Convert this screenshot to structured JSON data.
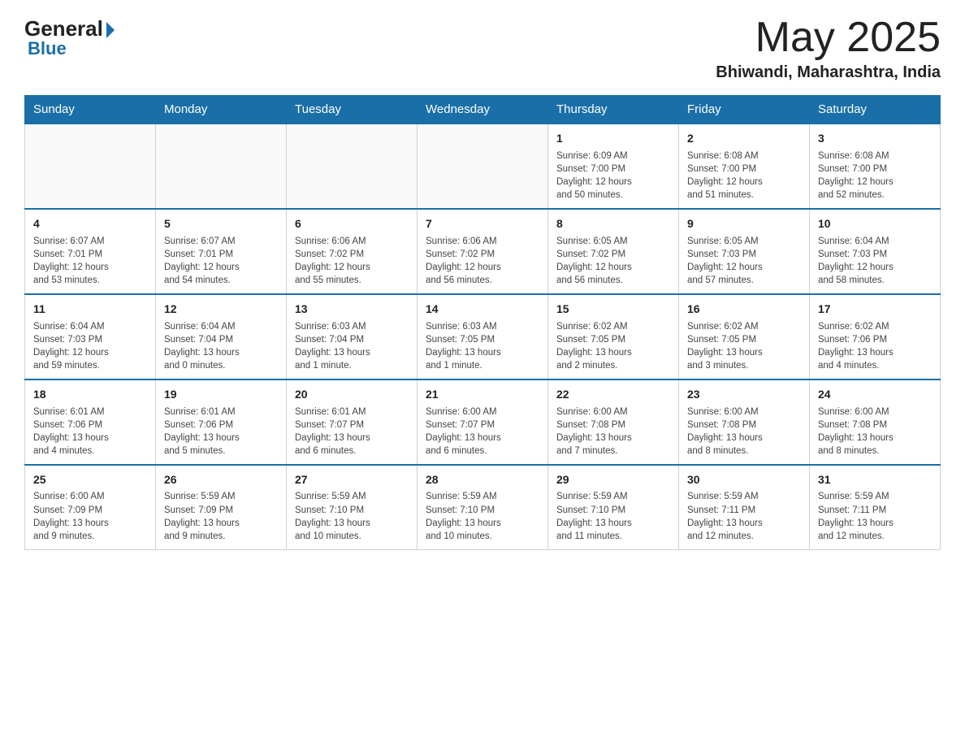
{
  "header": {
    "logo_general": "General",
    "logo_blue": "Blue",
    "month_title": "May 2025",
    "location": "Bhiwandi, Maharashtra, India"
  },
  "days_of_week": [
    "Sunday",
    "Monday",
    "Tuesday",
    "Wednesday",
    "Thursday",
    "Friday",
    "Saturday"
  ],
  "weeks": [
    [
      {
        "day": "",
        "info": ""
      },
      {
        "day": "",
        "info": ""
      },
      {
        "day": "",
        "info": ""
      },
      {
        "day": "",
        "info": ""
      },
      {
        "day": "1",
        "info": "Sunrise: 6:09 AM\nSunset: 7:00 PM\nDaylight: 12 hours\nand 50 minutes."
      },
      {
        "day": "2",
        "info": "Sunrise: 6:08 AM\nSunset: 7:00 PM\nDaylight: 12 hours\nand 51 minutes."
      },
      {
        "day": "3",
        "info": "Sunrise: 6:08 AM\nSunset: 7:00 PM\nDaylight: 12 hours\nand 52 minutes."
      }
    ],
    [
      {
        "day": "4",
        "info": "Sunrise: 6:07 AM\nSunset: 7:01 PM\nDaylight: 12 hours\nand 53 minutes."
      },
      {
        "day": "5",
        "info": "Sunrise: 6:07 AM\nSunset: 7:01 PM\nDaylight: 12 hours\nand 54 minutes."
      },
      {
        "day": "6",
        "info": "Sunrise: 6:06 AM\nSunset: 7:02 PM\nDaylight: 12 hours\nand 55 minutes."
      },
      {
        "day": "7",
        "info": "Sunrise: 6:06 AM\nSunset: 7:02 PM\nDaylight: 12 hours\nand 56 minutes."
      },
      {
        "day": "8",
        "info": "Sunrise: 6:05 AM\nSunset: 7:02 PM\nDaylight: 12 hours\nand 56 minutes."
      },
      {
        "day": "9",
        "info": "Sunrise: 6:05 AM\nSunset: 7:03 PM\nDaylight: 12 hours\nand 57 minutes."
      },
      {
        "day": "10",
        "info": "Sunrise: 6:04 AM\nSunset: 7:03 PM\nDaylight: 12 hours\nand 58 minutes."
      }
    ],
    [
      {
        "day": "11",
        "info": "Sunrise: 6:04 AM\nSunset: 7:03 PM\nDaylight: 12 hours\nand 59 minutes."
      },
      {
        "day": "12",
        "info": "Sunrise: 6:04 AM\nSunset: 7:04 PM\nDaylight: 13 hours\nand 0 minutes."
      },
      {
        "day": "13",
        "info": "Sunrise: 6:03 AM\nSunset: 7:04 PM\nDaylight: 13 hours\nand 1 minute."
      },
      {
        "day": "14",
        "info": "Sunrise: 6:03 AM\nSunset: 7:05 PM\nDaylight: 13 hours\nand 1 minute."
      },
      {
        "day": "15",
        "info": "Sunrise: 6:02 AM\nSunset: 7:05 PM\nDaylight: 13 hours\nand 2 minutes."
      },
      {
        "day": "16",
        "info": "Sunrise: 6:02 AM\nSunset: 7:05 PM\nDaylight: 13 hours\nand 3 minutes."
      },
      {
        "day": "17",
        "info": "Sunrise: 6:02 AM\nSunset: 7:06 PM\nDaylight: 13 hours\nand 4 minutes."
      }
    ],
    [
      {
        "day": "18",
        "info": "Sunrise: 6:01 AM\nSunset: 7:06 PM\nDaylight: 13 hours\nand 4 minutes."
      },
      {
        "day": "19",
        "info": "Sunrise: 6:01 AM\nSunset: 7:06 PM\nDaylight: 13 hours\nand 5 minutes."
      },
      {
        "day": "20",
        "info": "Sunrise: 6:01 AM\nSunset: 7:07 PM\nDaylight: 13 hours\nand 6 minutes."
      },
      {
        "day": "21",
        "info": "Sunrise: 6:00 AM\nSunset: 7:07 PM\nDaylight: 13 hours\nand 6 minutes."
      },
      {
        "day": "22",
        "info": "Sunrise: 6:00 AM\nSunset: 7:08 PM\nDaylight: 13 hours\nand 7 minutes."
      },
      {
        "day": "23",
        "info": "Sunrise: 6:00 AM\nSunset: 7:08 PM\nDaylight: 13 hours\nand 8 minutes."
      },
      {
        "day": "24",
        "info": "Sunrise: 6:00 AM\nSunset: 7:08 PM\nDaylight: 13 hours\nand 8 minutes."
      }
    ],
    [
      {
        "day": "25",
        "info": "Sunrise: 6:00 AM\nSunset: 7:09 PM\nDaylight: 13 hours\nand 9 minutes."
      },
      {
        "day": "26",
        "info": "Sunrise: 5:59 AM\nSunset: 7:09 PM\nDaylight: 13 hours\nand 9 minutes."
      },
      {
        "day": "27",
        "info": "Sunrise: 5:59 AM\nSunset: 7:10 PM\nDaylight: 13 hours\nand 10 minutes."
      },
      {
        "day": "28",
        "info": "Sunrise: 5:59 AM\nSunset: 7:10 PM\nDaylight: 13 hours\nand 10 minutes."
      },
      {
        "day": "29",
        "info": "Sunrise: 5:59 AM\nSunset: 7:10 PM\nDaylight: 13 hours\nand 11 minutes."
      },
      {
        "day": "30",
        "info": "Sunrise: 5:59 AM\nSunset: 7:11 PM\nDaylight: 13 hours\nand 12 minutes."
      },
      {
        "day": "31",
        "info": "Sunrise: 5:59 AM\nSunset: 7:11 PM\nDaylight: 13 hours\nand 12 minutes."
      }
    ]
  ]
}
